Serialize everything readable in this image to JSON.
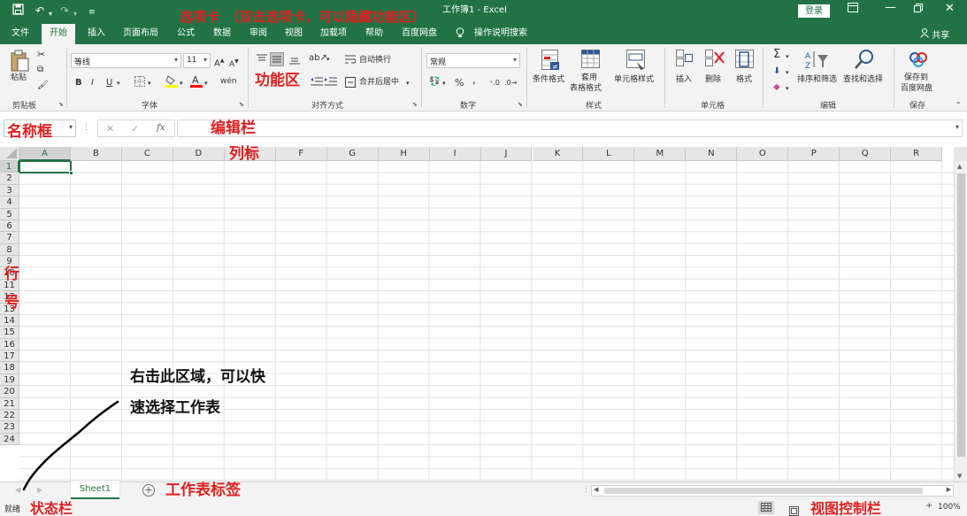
{
  "titlebar": {
    "title": "工作簿1 - Excel",
    "login_label": "登录",
    "icons": [
      "save-icon",
      "undo-icon",
      "redo-icon",
      "customize-icon",
      "ribbon-display-icon",
      "minimize-icon",
      "restore-icon",
      "close-icon"
    ]
  },
  "tabs": {
    "file": "文件",
    "home": "开始",
    "insert": "插入",
    "page_layout": "页面布局",
    "formulas": "公式",
    "data": "数据",
    "review": "审阅",
    "view": "视图",
    "addins": "加载项",
    "help": "帮助",
    "baidu": "百度网盘",
    "tell_me": "操作说明搜索",
    "share": "共享"
  },
  "ribbon": {
    "clipboard": {
      "paste": "粘贴",
      "label": "剪贴板"
    },
    "font": {
      "name": "等线",
      "size": "11",
      "label": "字体"
    },
    "alignment": {
      "wrap": "自动换行",
      "merge": "合并后居中",
      "label": "对齐方式"
    },
    "number": {
      "format": "常规",
      "label": "数字"
    },
    "styles": {
      "conditional": "条件格式",
      "table_line1": "套用",
      "table_line2": "表格格式",
      "cell_styles": "单元格样式",
      "label": "样式"
    },
    "cells": {
      "insert": "插入",
      "delete": "删除",
      "format": "格式",
      "label": "单元格"
    },
    "editing": {
      "sort": "排序和筛选",
      "find": "查找和选择",
      "label": "编辑"
    },
    "save": {
      "line1": "保存到",
      "line2": "百度网盘",
      "label": "保存"
    }
  },
  "formula_bar": {
    "name_value": "",
    "formula_value": ""
  },
  "columns": [
    "A",
    "B",
    "C",
    "D",
    "E",
    "F",
    "G",
    "H",
    "I",
    "J",
    "K",
    "L",
    "M",
    "N",
    "O",
    "P",
    "Q",
    "R"
  ],
  "rows": [
    "1",
    "2",
    "3",
    "4",
    "5",
    "6",
    "7",
    "8",
    "9",
    "10",
    "11",
    "12",
    "13",
    "14",
    "15",
    "16",
    "17",
    "18",
    "19",
    "20",
    "21",
    "22",
    "23",
    "24"
  ],
  "sheets": {
    "sheet1": "Sheet1"
  },
  "status": {
    "ready": "就绪",
    "zoom": "100%"
  },
  "annotations": {
    "tabs": "选项卡　（双击选项卡，可以隐藏功能区）",
    "ribbon": "功能区",
    "name_box": "名称框",
    "edit_bar": "编辑栏",
    "col_label": "列标",
    "row_label_1": "行",
    "row_label_2": "号",
    "sheet_tabs": "工作表标签",
    "status_bar": "状态栏",
    "view_bar": "视图控制栏",
    "note_line1": "右击此区域，可以快",
    "note_line2": "速选择工作表"
  },
  "colors": {
    "accent": "#217346",
    "annotation": "#e02020"
  }
}
